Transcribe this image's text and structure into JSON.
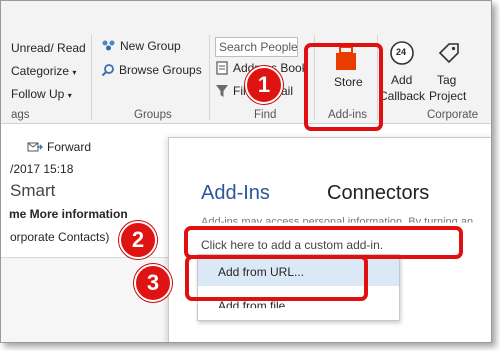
{
  "ribbon": {
    "unread_read": "Unread/ Read",
    "categorize": "Categorize",
    "follow_up": "Follow Up",
    "tags_group": "ags",
    "new_group": "New Group",
    "browse_groups": "Browse Groups",
    "groups_group": "Groups",
    "search_people_placeholder": "Search People",
    "address_book": "Address Book",
    "filter": "Filter Email",
    "find_group": "Find",
    "store": "Store",
    "addins_group": "Add-ins",
    "add_callback": [
      "Add",
      "Callback"
    ],
    "tag_project": [
      "Tag",
      "Project"
    ],
    "corporate_group": "Corporate",
    "callback_number": "24"
  },
  "message": {
    "forward_label": "Forward",
    "date": "/2017 15:18",
    "sender": "Smart",
    "more_info": "me More information",
    "contacts": "orporate Contacts)"
  },
  "dialog": {
    "tab_addins": "Add-Ins",
    "tab_connectors": "Connectors",
    "notice": "Add-ins may access personal information. By turning an",
    "custom_addin_link": "Click here to add a custom add-in."
  },
  "menu": {
    "items": [
      "Add from URL...",
      "Add from file..."
    ]
  },
  "annotations": {
    "badges": [
      "1",
      "2",
      "3"
    ],
    "color": "#e01010"
  }
}
